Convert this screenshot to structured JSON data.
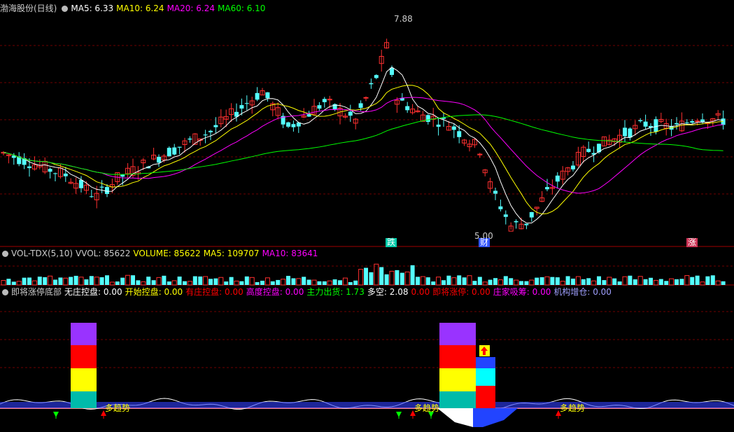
{
  "main_legend": {
    "title": "渤海股份(日线)",
    "items": [
      {
        "label": "MA5: 6.33",
        "color": "#ffffff"
      },
      {
        "label": "MA10: 6.24",
        "color": "#ffff00"
      },
      {
        "label": "MA20: 6.24",
        "color": "#ff00ff"
      },
      {
        "label": "MA60: 6.10",
        "color": "#00ff00"
      }
    ]
  },
  "price_annotations": {
    "high": "7.88",
    "low": "5.00"
  },
  "event_marks": {
    "mark1": "跌",
    "mark2": "财",
    "mark3": "涨"
  },
  "vol_legend": {
    "items": [
      {
        "label": "VOL-TDX(5,10)",
        "color": "#cccccc"
      },
      {
        "label": "VVOL: 85622",
        "color": "#cccccc"
      },
      {
        "label": "VOLUME: 85622",
        "color": "#ffff00"
      },
      {
        "label": "MA5: 109707",
        "color": "#ffff00"
      },
      {
        "label": "MA10: 83641",
        "color": "#ff00ff"
      }
    ]
  },
  "ind_legend": {
    "items": [
      {
        "label": "即将涨停底部",
        "color": "#cccccc"
      },
      {
        "label": "无庄控盘: 0.00",
        "color": "#ffffff"
      },
      {
        "label": "开始控盘: 0.00",
        "color": "#ffff00"
      },
      {
        "label": "有庄控盘: 0.00",
        "color": "#ff0000"
      },
      {
        "label": "高度控盘: 0.00",
        "color": "#ff00ff"
      },
      {
        "label": "主力出货: 1.73",
        "color": "#00ff00"
      },
      {
        "label": "多空: 2.08",
        "color": "#ffffff"
      },
      {
        "label": "0.00",
        "color": "#ff0000"
      },
      {
        "label": "即将涨停: 0.00",
        "color": "#ff0000"
      },
      {
        "label": "庄家吸筹: 0.00",
        "color": "#ff00ff"
      },
      {
        "label": "机构增仓: 0.00",
        "color": "#a0a0ff"
      }
    ]
  },
  "trend_labels": {
    "t1": "多趋势",
    "t2": "多趋势",
    "t3": "多趋势"
  },
  "chart_data": {
    "type": "candlestick",
    "title": "渤海股份(日线)",
    "price_high": 7.88,
    "price_low": 5.0,
    "ma_values": {
      "MA5": 6.33,
      "MA10": 6.24,
      "MA20": 6.24,
      "MA60": 6.1
    },
    "volume": {
      "VVOL": 85622,
      "VOLUME": 85622,
      "MA5": 109707,
      "MA10": 83641
    }
  }
}
